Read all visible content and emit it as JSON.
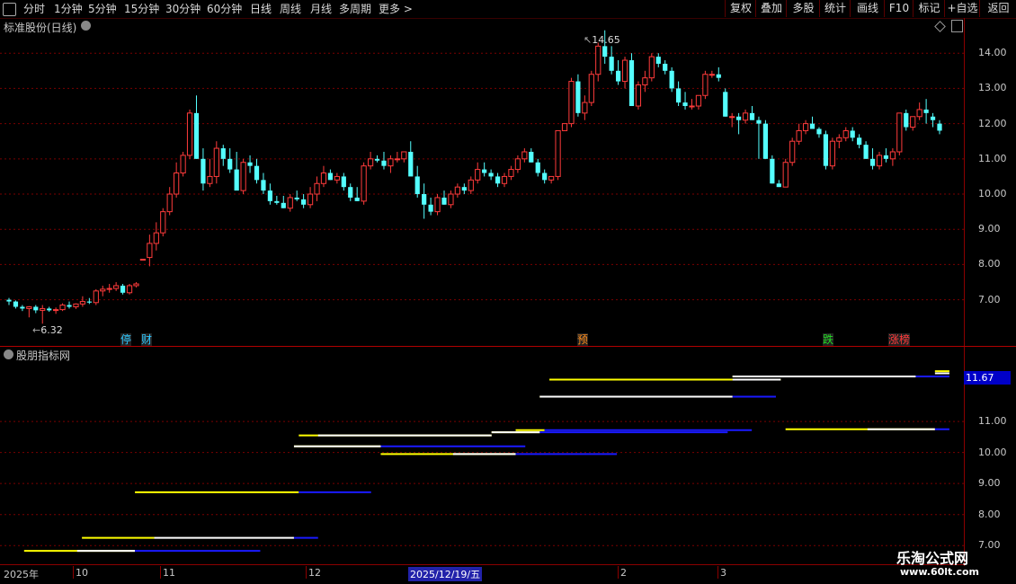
{
  "toolbar": {
    "left_tabs": [
      "分时",
      "1分钟",
      "5分钟",
      "15分钟",
      "30分钟",
      "60分钟",
      "日线",
      "周线",
      "月线",
      "多周期",
      "更多 >"
    ],
    "right_buttons": [
      "复权",
      "叠加",
      "多股",
      "统计",
      "画线",
      "F10",
      "标记",
      "+自选",
      "返回"
    ]
  },
  "main_panel": {
    "title": "标准股份(日线)",
    "high_label": "14.65",
    "low_label": "6.32",
    "y_axis": [
      "14.00",
      "13.00",
      "12.00",
      "11.00",
      "10.00",
      "9.00",
      "8.00",
      "7.00"
    ],
    "tags": [
      {
        "text": "停",
        "color": "#2fc8ff"
      },
      {
        "text": "财",
        "color": "#2fc8ff"
      },
      {
        "text": "预",
        "color": "#ff8c1a"
      },
      {
        "text": "跌",
        "color": "#22dd22"
      },
      {
        "text": "涨榜",
        "color": "#ff3a3a"
      }
    ]
  },
  "indicator_panel": {
    "title": "股朋指标网",
    "current_value": "11.67",
    "y_axis": [
      "11.00",
      "10.00",
      "9.00",
      "8.00",
      "7.00"
    ]
  },
  "date_axis": [
    "2025年",
    "10",
    "11",
    "12",
    "2025/12/19/五",
    "2",
    "3"
  ],
  "watermark": {
    "line1": "乐淘公式网",
    "line2": "www.60lt.com"
  },
  "colors": {
    "up": "#ff3b3b",
    "down": "#54ffff",
    "grid": "#8b0000",
    "yellow": "#ffff00",
    "white": "#ffffff",
    "blue": "#1a1aff"
  },
  "chart_data": {
    "type": "candlestick",
    "ylim": [
      6.2,
      15.0
    ],
    "candles": [
      [
        7.0,
        7.05,
        6.85,
        6.95
      ],
      [
        6.95,
        6.98,
        6.75,
        6.8
      ],
      [
        6.8,
        6.85,
        6.68,
        6.75
      ],
      [
        6.75,
        6.82,
        6.5,
        6.8
      ],
      [
        6.8,
        6.85,
        6.62,
        6.7
      ],
      [
        6.7,
        6.85,
        6.32,
        6.75
      ],
      [
        6.75,
        6.8,
        6.66,
        6.7
      ],
      [
        6.7,
        6.78,
        6.6,
        6.72
      ],
      [
        6.72,
        6.9,
        6.68,
        6.85
      ],
      [
        6.85,
        6.95,
        6.75,
        6.8
      ],
      [
        6.8,
        6.9,
        6.74,
        6.88
      ],
      [
        6.88,
        7.1,
        6.8,
        6.95
      ],
      [
        6.95,
        7.05,
        6.88,
        6.92
      ],
      [
        6.92,
        7.3,
        6.85,
        7.25
      ],
      [
        7.25,
        7.4,
        7.1,
        7.3
      ],
      [
        7.3,
        7.45,
        7.2,
        7.32
      ],
      [
        7.32,
        7.5,
        7.25,
        7.4
      ],
      [
        7.4,
        7.45,
        7.15,
        7.2
      ],
      [
        7.2,
        7.45,
        7.15,
        7.4
      ],
      [
        7.4,
        7.5,
        7.35,
        7.45
      ],
      [
        8.15,
        8.15,
        8.15,
        8.15
      ],
      [
        8.2,
        8.85,
        7.95,
        8.6
      ],
      [
        8.6,
        9.2,
        8.4,
        8.9
      ],
      [
        8.9,
        9.6,
        8.8,
        9.5
      ],
      [
        9.5,
        10.2,
        9.4,
        10.0
      ],
      [
        10.0,
        10.9,
        9.9,
        10.6
      ],
      [
        10.6,
        11.2,
        10.5,
        11.1
      ],
      [
        11.1,
        12.4,
        11.0,
        12.3
      ],
      [
        12.3,
        12.8,
        11.0,
        11.0
      ],
      [
        11.0,
        11.3,
        10.1,
        10.3
      ],
      [
        10.3,
        11.0,
        10.2,
        10.5
      ],
      [
        10.5,
        11.5,
        10.3,
        11.3
      ],
      [
        11.3,
        11.4,
        10.8,
        11.0
      ],
      [
        11.0,
        11.3,
        10.6,
        10.7
      ],
      [
        10.7,
        11.2,
        10.4,
        10.1
      ],
      [
        10.1,
        11.0,
        10.0,
        10.9
      ],
      [
        10.9,
        11.1,
        10.6,
        10.8
      ],
      [
        10.8,
        11.0,
        10.3,
        10.4
      ],
      [
        10.4,
        10.6,
        10.0,
        10.1
      ],
      [
        10.1,
        10.3,
        9.7,
        9.8
      ],
      [
        9.8,
        9.95,
        9.7,
        9.75
      ],
      [
        9.75,
        9.95,
        9.6,
        9.6
      ],
      [
        9.6,
        10.0,
        9.5,
        9.9
      ],
      [
        9.9,
        10.1,
        9.8,
        9.85
      ],
      [
        9.85,
        10.0,
        9.6,
        9.7
      ],
      [
        9.7,
        10.2,
        9.6,
        10.0
      ],
      [
        10.0,
        10.5,
        9.8,
        10.3
      ],
      [
        10.3,
        10.8,
        10.2,
        10.6
      ],
      [
        10.6,
        10.7,
        10.4,
        10.4
      ],
      [
        10.4,
        10.6,
        10.3,
        10.5
      ],
      [
        10.5,
        10.6,
        10.1,
        10.2
      ],
      [
        10.2,
        10.3,
        9.8,
        9.9
      ],
      [
        9.9,
        10.2,
        9.8,
        9.8
      ],
      [
        9.8,
        10.9,
        9.7,
        10.8
      ],
      [
        10.8,
        11.2,
        10.7,
        11.0
      ],
      [
        11.0,
        11.1,
        10.9,
        10.95
      ],
      [
        10.95,
        11.2,
        10.7,
        10.8
      ],
      [
        10.8,
        11.1,
        10.6,
        11.0
      ],
      [
        11.0,
        11.2,
        10.9,
        11.0
      ],
      [
        11.0,
        11.2,
        10.9,
        11.2
      ],
      [
        11.2,
        11.5,
        11.0,
        10.5
      ],
      [
        10.5,
        10.8,
        9.9,
        10.0
      ],
      [
        10.0,
        10.3,
        9.3,
        9.7
      ],
      [
        9.7,
        9.9,
        9.4,
        9.5
      ],
      [
        9.5,
        10.0,
        9.4,
        9.9
      ],
      [
        9.9,
        10.1,
        9.7,
        9.7
      ],
      [
        9.7,
        10.1,
        9.6,
        10.0
      ],
      [
        10.0,
        10.3,
        9.9,
        10.2
      ],
      [
        10.2,
        10.3,
        10.0,
        10.1
      ],
      [
        10.1,
        10.5,
        10.0,
        10.4
      ],
      [
        10.4,
        10.9,
        10.3,
        10.7
      ],
      [
        10.7,
        10.9,
        10.5,
        10.6
      ],
      [
        10.6,
        10.7,
        10.4,
        10.5
      ],
      [
        10.5,
        10.6,
        10.2,
        10.3
      ],
      [
        10.3,
        10.6,
        10.2,
        10.5
      ],
      [
        10.5,
        10.8,
        10.4,
        10.7
      ],
      [
        10.7,
        11.1,
        10.6,
        11.0
      ],
      [
        11.0,
        11.3,
        10.9,
        11.2
      ],
      [
        11.2,
        11.3,
        10.9,
        10.9
      ],
      [
        10.9,
        11.0,
        10.5,
        10.6
      ],
      [
        10.6,
        10.7,
        10.3,
        10.4
      ],
      [
        10.4,
        10.5,
        10.3,
        10.5
      ],
      [
        10.5,
        11.8,
        10.4,
        11.8
      ],
      [
        11.8,
        12.0,
        11.8,
        12.0
      ],
      [
        12.0,
        13.3,
        11.9,
        13.2
      ],
      [
        13.2,
        13.4,
        12.2,
        12.3
      ],
      [
        12.3,
        12.8,
        12.1,
        12.6
      ],
      [
        12.6,
        13.5,
        12.5,
        13.4
      ],
      [
        13.4,
        14.3,
        13.2,
        14.2
      ],
      [
        14.2,
        14.65,
        13.7,
        13.9
      ],
      [
        13.9,
        14.2,
        13.4,
        13.5
      ],
      [
        13.5,
        13.8,
        13.1,
        13.2
      ],
      [
        13.2,
        13.9,
        13.0,
        13.8
      ],
      [
        13.8,
        14.0,
        12.5,
        12.5
      ],
      [
        12.5,
        13.2,
        12.4,
        13.1
      ],
      [
        13.1,
        13.5,
        12.9,
        13.3
      ],
      [
        13.3,
        14.0,
        13.2,
        13.9
      ],
      [
        13.9,
        14.0,
        13.6,
        13.7
      ],
      [
        13.7,
        13.8,
        13.4,
        13.5
      ],
      [
        13.5,
        13.6,
        12.9,
        13.0
      ],
      [
        13.0,
        13.2,
        12.5,
        12.6
      ],
      [
        12.6,
        12.9,
        12.4,
        12.5
      ],
      [
        12.5,
        12.7,
        12.4,
        12.5
      ],
      [
        12.5,
        12.8,
        12.4,
        12.8
      ],
      [
        12.8,
        13.5,
        12.7,
        13.4
      ],
      [
        13.4,
        13.5,
        13.3,
        13.4
      ],
      [
        13.4,
        13.6,
        13.2,
        13.3
      ],
      [
        12.9,
        13.0,
        12.2,
        12.2
      ],
      [
        12.2,
        12.3,
        11.9,
        12.2
      ],
      [
        12.2,
        12.3,
        11.7,
        12.1
      ],
      [
        12.1,
        12.4,
        12.0,
        12.3
      ],
      [
        12.3,
        12.5,
        12.1,
        12.1
      ],
      [
        12.1,
        12.2,
        11.0,
        12.0
      ],
      [
        12.0,
        12.1,
        11.0,
        11.0
      ],
      [
        11.0,
        11.1,
        10.3,
        10.3
      ],
      [
        10.3,
        10.4,
        10.2,
        10.2
      ],
      [
        10.2,
        11.0,
        10.2,
        10.9
      ],
      [
        10.9,
        11.6,
        10.8,
        11.5
      ],
      [
        11.5,
        12.0,
        11.4,
        11.8
      ],
      [
        11.8,
        12.1,
        11.7,
        12.0
      ],
      [
        12.0,
        12.2,
        11.9,
        11.85
      ],
      [
        11.85,
        11.9,
        11.6,
        11.7
      ],
      [
        11.7,
        11.8,
        10.7,
        10.8
      ],
      [
        10.8,
        11.6,
        10.7,
        11.5
      ],
      [
        11.5,
        11.7,
        11.3,
        11.6
      ],
      [
        11.6,
        11.9,
        11.5,
        11.8
      ],
      [
        11.8,
        11.9,
        11.5,
        11.6
      ],
      [
        11.6,
        11.7,
        11.3,
        11.4
      ],
      [
        11.4,
        11.5,
        11.0,
        11.0
      ],
      [
        11.0,
        11.3,
        10.7,
        10.8
      ],
      [
        10.8,
        11.2,
        10.7,
        11.1
      ],
      [
        11.1,
        11.3,
        10.9,
        11.0
      ],
      [
        11.0,
        11.3,
        10.8,
        11.2
      ],
      [
        11.2,
        12.3,
        11.1,
        12.3
      ],
      [
        12.3,
        12.4,
        11.8,
        11.9
      ],
      [
        11.9,
        12.2,
        11.8,
        12.2
      ],
      [
        12.2,
        12.6,
        12.1,
        12.4
      ],
      [
        12.4,
        12.7,
        12.0,
        12.3
      ],
      [
        12.2,
        12.3,
        11.9,
        12.1
      ],
      [
        12.0,
        12.1,
        11.7,
        11.8
      ]
    ],
    "indicator_segments": [
      {
        "color": "yellow",
        "y": 6.83,
        "x1": 0.025,
        "x2": 0.14
      },
      {
        "color": "white",
        "y": 6.83,
        "x1": 0.08,
        "x2": 0.14
      },
      {
        "color": "blue",
        "y": 6.83,
        "x1": 0.14,
        "x2": 0.27
      },
      {
        "color": "yellow",
        "y": 7.25,
        "x1": 0.085,
        "x2": 0.16
      },
      {
        "color": "white",
        "y": 7.25,
        "x1": 0.16,
        "x2": 0.305
      },
      {
        "color": "blue",
        "y": 7.25,
        "x1": 0.305,
        "x2": 0.33
      },
      {
        "color": "yellow",
        "y": 8.72,
        "x1": 0.14,
        "x2": 0.31
      },
      {
        "color": "blue",
        "y": 8.72,
        "x1": 0.31,
        "x2": 0.385
      },
      {
        "color": "yellow",
        "y": 10.2,
        "x1": 0.305,
        "x2": 0.395
      },
      {
        "color": "white",
        "y": 10.2,
        "x1": 0.305,
        "x2": 0.395
      },
      {
        "color": "blue",
        "y": 10.2,
        "x1": 0.395,
        "x2": 0.545
      },
      {
        "color": "yellow",
        "y": 10.55,
        "x1": 0.31,
        "x2": 0.51
      },
      {
        "color": "white",
        "y": 10.55,
        "x1": 0.33,
        "x2": 0.51
      },
      {
        "color": "yellow",
        "y": 10.65,
        "x1": 0.51,
        "x2": 0.56
      },
      {
        "color": "white",
        "y": 10.65,
        "x1": 0.51,
        "x2": 0.56
      },
      {
        "color": "blue",
        "y": 10.65,
        "x1": 0.56,
        "x2": 0.755
      },
      {
        "color": "yellow",
        "y": 10.72,
        "x1": 0.535,
        "x2": 0.565
      },
      {
        "color": "blue",
        "y": 10.72,
        "x1": 0.565,
        "x2": 0.78
      },
      {
        "color": "yellow",
        "y": 9.95,
        "x1": 0.395,
        "x2": 0.535
      },
      {
        "color": "white",
        "y": 9.95,
        "x1": 0.47,
        "x2": 0.535
      },
      {
        "color": "blue",
        "y": 9.95,
        "x1": 0.535,
        "x2": 0.64
      },
      {
        "color": "yellow",
        "y": 11.8,
        "x1": 0.56,
        "x2": 0.76
      },
      {
        "color": "white",
        "y": 11.8,
        "x1": 0.56,
        "x2": 0.76
      },
      {
        "color": "blue",
        "y": 11.8,
        "x1": 0.76,
        "x2": 0.805
      },
      {
        "color": "yellow",
        "y": 12.35,
        "x1": 0.57,
        "x2": 0.81
      },
      {
        "color": "white",
        "y": 12.35,
        "x1": 0.76,
        "x2": 0.81
      },
      {
        "color": "yellow",
        "y": 12.45,
        "x1": 0.76,
        "x2": 0.95
      },
      {
        "color": "white",
        "y": 12.45,
        "x1": 0.76,
        "x2": 0.95
      },
      {
        "color": "blue",
        "y": 12.45,
        "x1": 0.95,
        "x2": 1.01
      },
      {
        "color": "yellow",
        "y": 12.62,
        "x1": 0.97,
        "x2": 1.01
      },
      {
        "color": "white",
        "y": 12.55,
        "x1": 0.97,
        "x2": 1.01
      },
      {
        "color": "yellow",
        "y": 10.75,
        "x1": 0.815,
        "x2": 0.97
      },
      {
        "color": "white",
        "y": 10.75,
        "x1": 0.9,
        "x2": 0.97
      },
      {
        "color": "blue",
        "y": 10.75,
        "x1": 0.97,
        "x2": 1.01
      }
    ]
  }
}
